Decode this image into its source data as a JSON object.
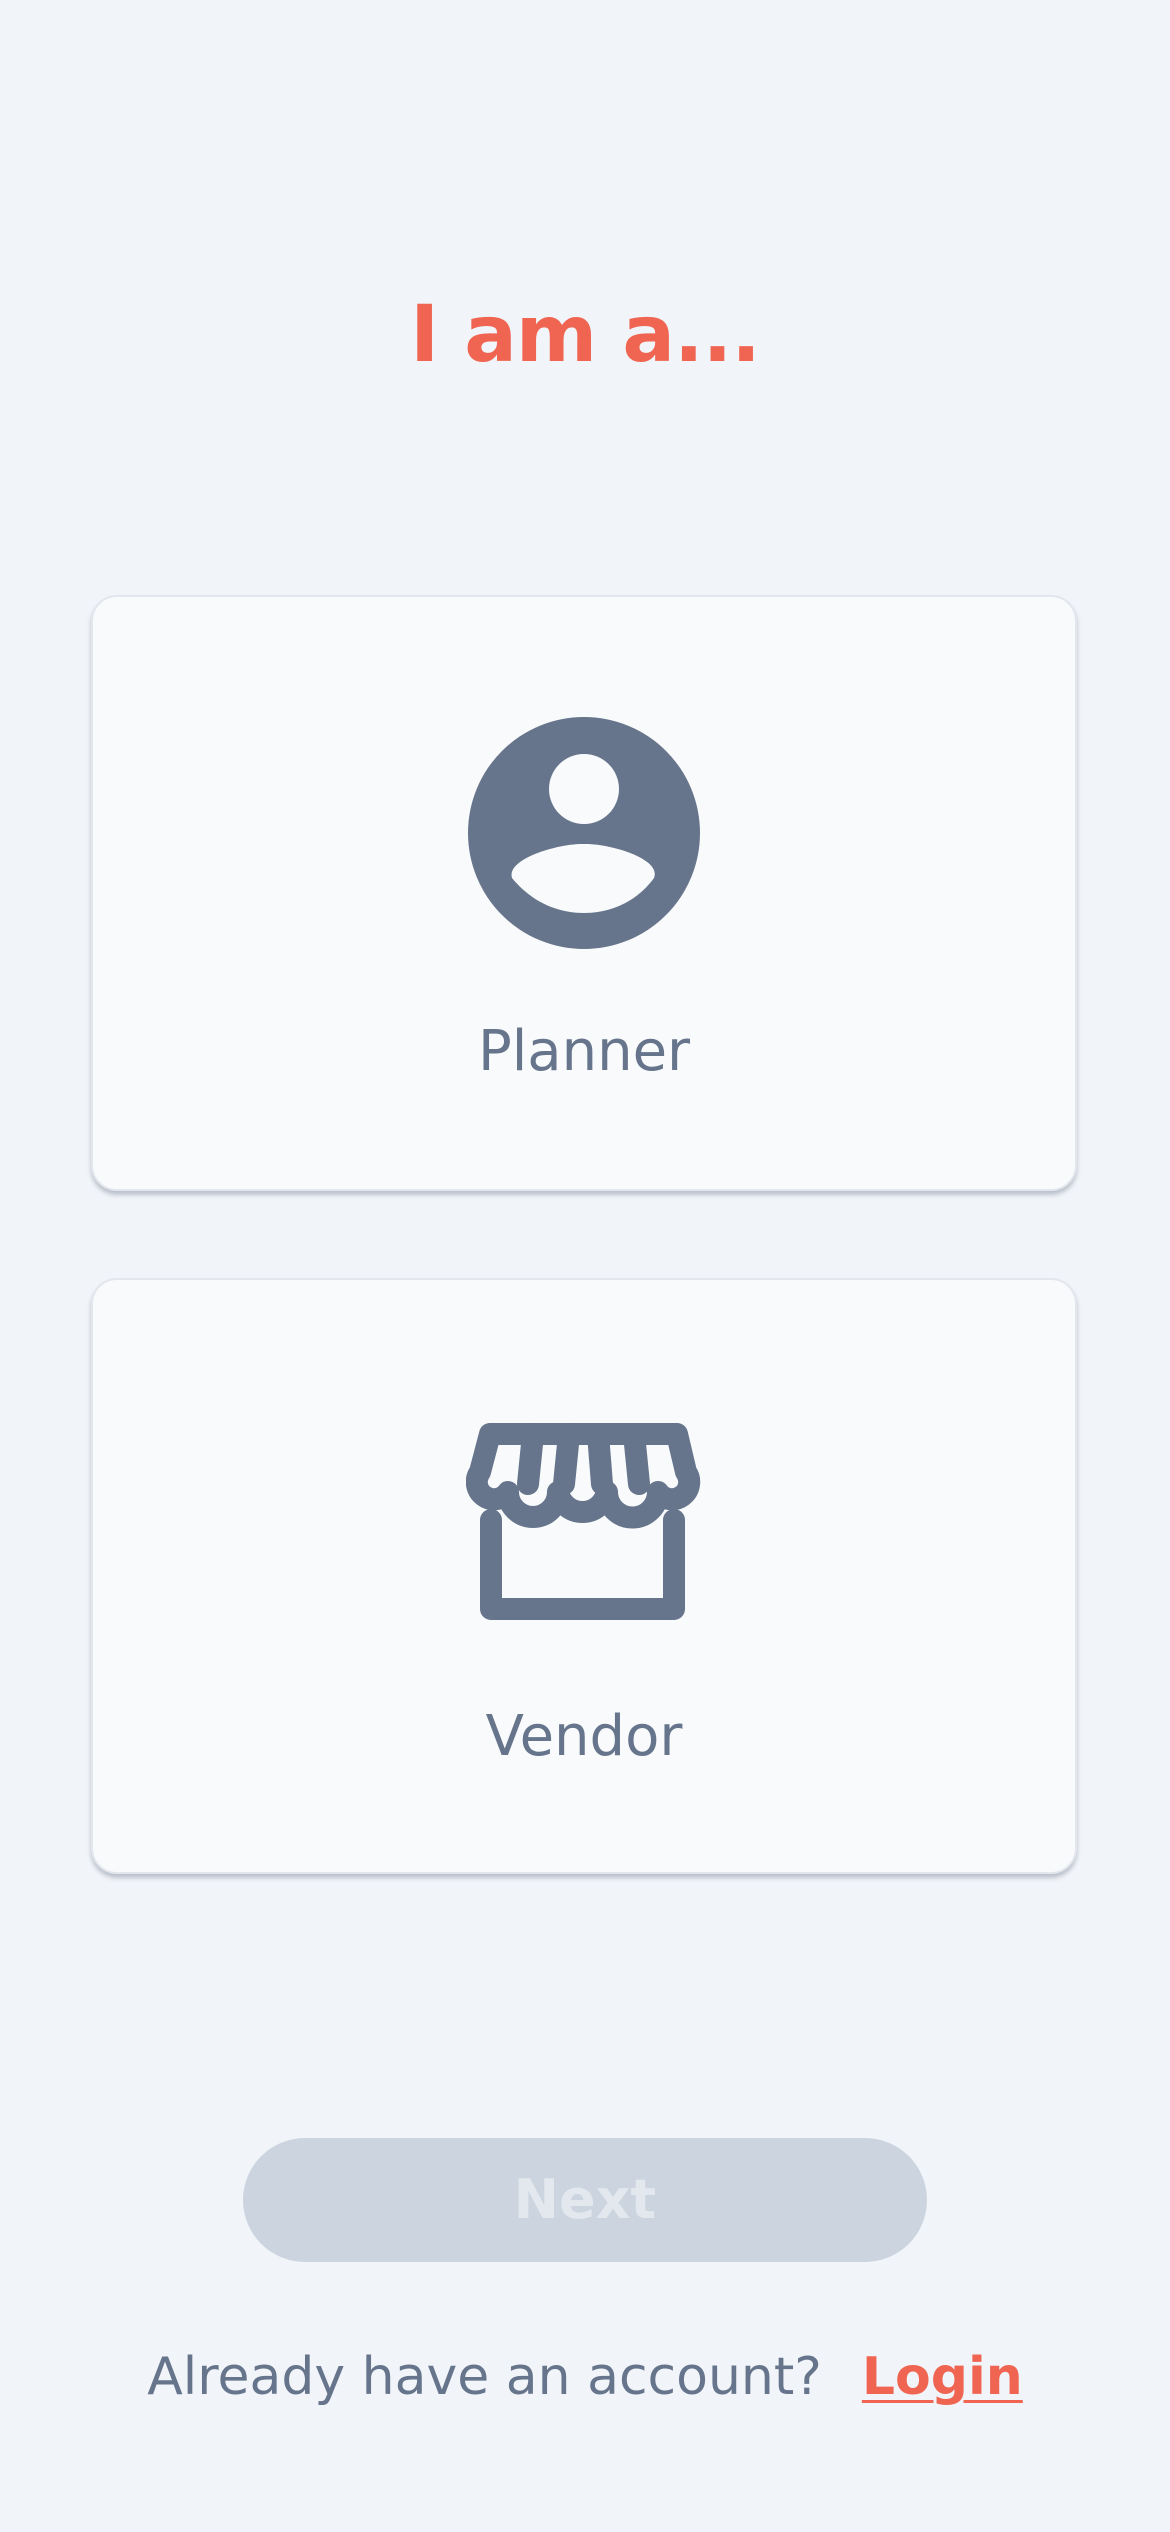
{
  "heading": "I am a...",
  "roles": [
    {
      "label": "Planner",
      "icon": "account-circle-icon"
    },
    {
      "label": "Vendor",
      "icon": "storefront-icon"
    }
  ],
  "next_button": {
    "label": "Next",
    "state": "disabled"
  },
  "footer": {
    "prompt": "Already have an account?",
    "login_label": "Login"
  },
  "colors": {
    "accent": "#f06552",
    "icon_text": "#66758b",
    "background": "#f1f4f9",
    "card": "#f9fafc",
    "button_disabled": "#cbd4df"
  }
}
